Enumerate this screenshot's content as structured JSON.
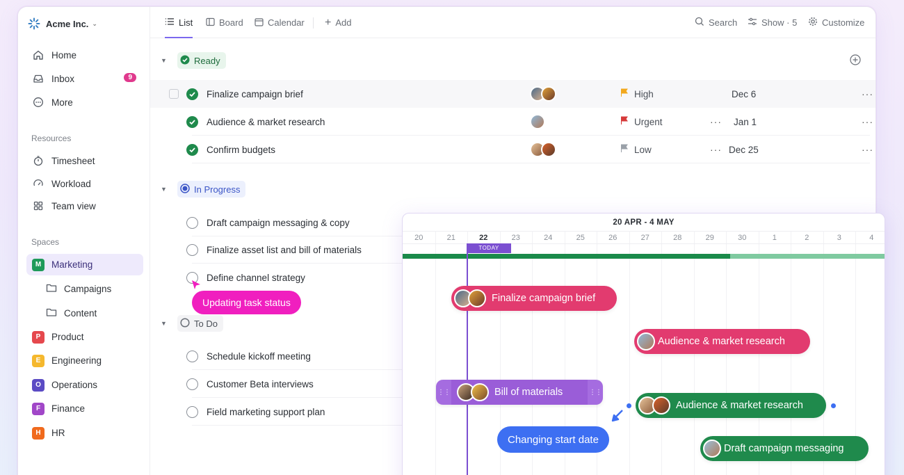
{
  "workspace": {
    "name": "Acme Inc."
  },
  "sidebar": {
    "nav": [
      {
        "label": "Home",
        "icon": "home-icon"
      },
      {
        "label": "Inbox",
        "icon": "inbox-icon",
        "badge": "9"
      },
      {
        "label": "More",
        "icon": "more-icon"
      }
    ],
    "resources_label": "Resources",
    "resources": [
      {
        "label": "Timesheet",
        "icon": "timer-icon"
      },
      {
        "label": "Workload",
        "icon": "workload-icon"
      },
      {
        "label": "Team view",
        "icon": "grid-icon"
      }
    ],
    "spaces_label": "Spaces",
    "spaces": [
      {
        "letter": "M",
        "label": "Marketing",
        "color": "#1f9a5a"
      },
      {
        "letter": "P",
        "label": "Product",
        "color": "#e5484d"
      },
      {
        "letter": "E",
        "label": "Engineering",
        "color": "#f5b82e"
      },
      {
        "letter": "O",
        "label": "Operations",
        "color": "#5b4bc4"
      },
      {
        "letter": "F",
        "label": "Finance",
        "color": "#a147c8"
      },
      {
        "letter": "H",
        "label": "HR",
        "color": "#f06a1d"
      }
    ],
    "folders": [
      {
        "label": "Campaigns"
      },
      {
        "label": "Content"
      }
    ]
  },
  "topbar": {
    "tabs": [
      {
        "label": "List"
      },
      {
        "label": "Board"
      },
      {
        "label": "Calendar"
      },
      {
        "label": "Add"
      }
    ],
    "search": "Search",
    "show": "Show · 5",
    "customize": "Customize"
  },
  "groups": {
    "ready": {
      "label": "Ready",
      "tasks": [
        {
          "name": "Finalize campaign brief",
          "priority": "High",
          "priority_color": "#f2a81d",
          "date": "Dec 6"
        },
        {
          "name": "Audience & market research",
          "priority": "Urgent",
          "priority_color": "#d63a3a",
          "date": "Jan 1"
        },
        {
          "name": "Confirm budgets",
          "priority": "Low",
          "priority_color": "#9aa0a8",
          "date": "Dec 25"
        }
      ]
    },
    "progress": {
      "label": "In Progress",
      "tasks": [
        {
          "name": "Draft campaign messaging & copy"
        },
        {
          "name": "Finalize asset list and bill of materials"
        },
        {
          "name": "Define channel strategy"
        }
      ]
    },
    "todo": {
      "label": "To Do",
      "tasks": [
        {
          "name": "Schedule kickoff meeting"
        },
        {
          "name": "Customer Beta interviews"
        },
        {
          "name": "Field marketing support plan"
        }
      ]
    }
  },
  "callouts": {
    "status": "Updating task status",
    "start_date": "Changing start date"
  },
  "gantt": {
    "range": "20 APR - 4 MAY",
    "days": [
      "20",
      "21",
      "22",
      "23",
      "24",
      "25",
      "26",
      "27",
      "28",
      "29",
      "30",
      "1",
      "2",
      "3",
      "4"
    ],
    "today_label": "TODAY",
    "progress_fraction": 0.68,
    "bars": [
      {
        "label": "Finalize campaign brief",
        "color": "pink"
      },
      {
        "label": "Audience & market research",
        "color": "pink"
      },
      {
        "label": "Bill of materials",
        "color": "purple"
      },
      {
        "label": "Audience & market research",
        "color": "green"
      },
      {
        "label": "Draft campaign messaging",
        "color": "green"
      }
    ]
  }
}
